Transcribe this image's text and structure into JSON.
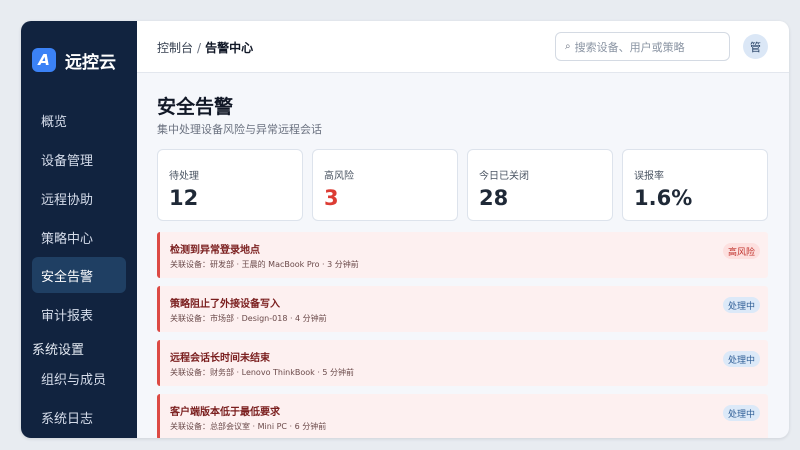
{
  "brand": {
    "logo_letter": "A",
    "name": "远控云"
  },
  "sidebar": {
    "items": [
      {
        "label": "概览",
        "active": false
      },
      {
        "label": "设备管理",
        "active": false
      },
      {
        "label": "远程协助",
        "active": false
      },
      {
        "label": "策略中心",
        "active": false
      },
      {
        "label": "安全告警",
        "active": true
      },
      {
        "label": "审计报表",
        "active": false
      }
    ],
    "section_label": "系统设置",
    "section_items": [
      {
        "label": "组织与成员"
      },
      {
        "label": "系统日志"
      }
    ]
  },
  "header": {
    "breadcrumb": {
      "parent": "控制台",
      "separator": "/",
      "current": "告警中心"
    },
    "search": {
      "icon": "search-icon",
      "placeholder": "搜索设备、用户或策略"
    },
    "avatar_text": "管"
  },
  "page": {
    "title": "安全告警",
    "subtitle": "集中处理设备风险与异常远程会话"
  },
  "stats": [
    {
      "label": "待处理",
      "value": "12"
    },
    {
      "label": "高风险",
      "value": "3"
    },
    {
      "label": "今日已关闭",
      "value": "28"
    },
    {
      "label": "误报率",
      "value": "1.6%"
    }
  ],
  "alerts": [
    {
      "title": "检测到异常登录地点",
      "meta": "关联设备：研发部 · 王晨的 MacBook Pro · 3 分钟前",
      "badge": "高风险",
      "badge_type": "high"
    },
    {
      "title": "策略阻止了外接设备写入",
      "meta": "关联设备：市场部 · Design-018 · 4 分钟前",
      "badge": "处理中",
      "badge_type": "processing"
    },
    {
      "title": "远程会话长时间未结束",
      "meta": "关联设备：财务部 · Lenovo ThinkBook · 5 分钟前",
      "badge": "处理中",
      "badge_type": "processing"
    },
    {
      "title": "客户端版本低于最低要求",
      "meta": "关联设备：总部会议室 · Mini PC · 6 分钟前",
      "badge": "处理中",
      "badge_type": "processing"
    }
  ],
  "colors": {
    "sidebar_bg": "#11233f",
    "accent": "#3b82f6",
    "danger": "#dc3c34",
    "alert_bg": "#fdf0f0",
    "alert_border": "#dc4a44"
  }
}
